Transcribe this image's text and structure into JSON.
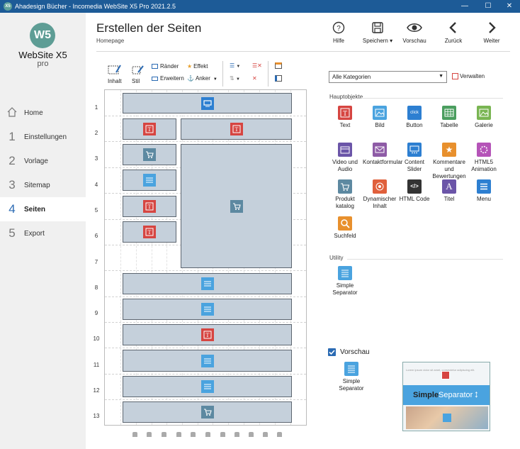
{
  "window": {
    "title": "Ahadesign Bücher - Incomedia WebSite X5 Pro 2021.2.5",
    "app_icon": "X5",
    "controls": [
      "minimize-icon",
      "maximize-icon",
      "close-icon"
    ]
  },
  "logo": {
    "badge": "W5",
    "brand": "WebSite X5",
    "edition": "pro"
  },
  "sidebar": {
    "items": [
      {
        "num": "",
        "icon": "home-icon",
        "label": "Home"
      },
      {
        "num": "1",
        "label": "Einstellungen"
      },
      {
        "num": "2",
        "label": "Vorlage"
      },
      {
        "num": "3",
        "label": "Sitemap"
      },
      {
        "num": "4",
        "label": "Seiten",
        "active": true
      },
      {
        "num": "5",
        "label": "Export"
      }
    ]
  },
  "header": {
    "title": "Erstellen der Seiten",
    "breadcrumb": "Homepage",
    "toolbar": [
      {
        "icon": "help-icon",
        "label": "Hilfe"
      },
      {
        "icon": "save-icon",
        "label": "Speichern ▾"
      },
      {
        "icon": "eye-icon",
        "label": "Vorschau"
      },
      {
        "icon": "chevron-left-icon",
        "label": "Zurück"
      },
      {
        "icon": "chevron-right-icon",
        "label": "Weiter"
      }
    ]
  },
  "editor_toolbar": {
    "content": "Inhalt",
    "style": "Stil",
    "borders": "Ränder",
    "effect": "Effekt",
    "extend": "Erweitern",
    "anchor": "Anker"
  },
  "grid": {
    "rows": [
      "1",
      "2",
      "3",
      "4",
      "5",
      "6",
      "7",
      "8",
      "9",
      "10",
      "11",
      "12",
      "13"
    ]
  },
  "right_panel": {
    "category": "Alle Kategorien",
    "manage": "Verwalten",
    "main_objects_header": "Hauptobjekte",
    "main_objects": [
      {
        "label": "Text",
        "icon": "text-icon",
        "color": "#d64541"
      },
      {
        "label": "Bild",
        "icon": "image-icon",
        "color": "#4aa3df"
      },
      {
        "label": "Button",
        "icon": "button-icon",
        "color": "#2d7fd1"
      },
      {
        "label": "Tabelle",
        "icon": "table-icon",
        "color": "#4b9e5f"
      },
      {
        "label": "Galerie",
        "icon": "gallery-icon",
        "color": "#79b552"
      },
      {
        "label": "Video und Audio",
        "icon": "video-icon",
        "color": "#6b55a8"
      },
      {
        "label": "Kontaktformular",
        "icon": "mail-icon",
        "color": "#8e5ba6"
      },
      {
        "label": "Content Slider",
        "icon": "slider-icon",
        "color": "#2d7fd1"
      },
      {
        "label": "Kommentare und Bewertungen",
        "icon": "star-icon",
        "color": "#e8902d"
      },
      {
        "label": "HTML5 Animation",
        "icon": "animation-icon",
        "color": "#b554b8"
      },
      {
        "label": "Produkt katalog",
        "icon": "cart-icon",
        "color": "#5d89a1"
      },
      {
        "label": "Dynamischer Inhalt",
        "icon": "dynamic-icon",
        "color": "#e0603c"
      },
      {
        "label": "HTML Code",
        "icon": "code-icon",
        "color": "#333333"
      },
      {
        "label": "Titel",
        "icon": "title-icon",
        "color": "#6b55a8"
      },
      {
        "label": "Menu",
        "icon": "menu-icon",
        "color": "#2d7fd1"
      },
      {
        "label": "Suchfeld",
        "icon": "search-icon",
        "color": "#e8902d"
      }
    ],
    "utility_header": "Utility",
    "utility_objects": [
      {
        "label": "Simple Separator",
        "icon": "separator-icon",
        "color": "#4aa3df"
      }
    ],
    "preview": {
      "checked": true,
      "label": "Vorschau",
      "item_label": "Simple Separator",
      "thumb_text": "Lorem ipsum dolor sit amet, consectetur adipiscing elit.",
      "thumb_title_bold": "Simple",
      "thumb_title_rest": " Separator"
    }
  },
  "colors": {
    "titlebar": "#1d5b97",
    "accent": "#2a6ab3",
    "cell_bg": "#c5d0db",
    "text_obj": "#d64541",
    "separator_obj": "#4aa3df",
    "cart_obj": "#5d89a1",
    "slider_obj": "#2d7fd1"
  }
}
